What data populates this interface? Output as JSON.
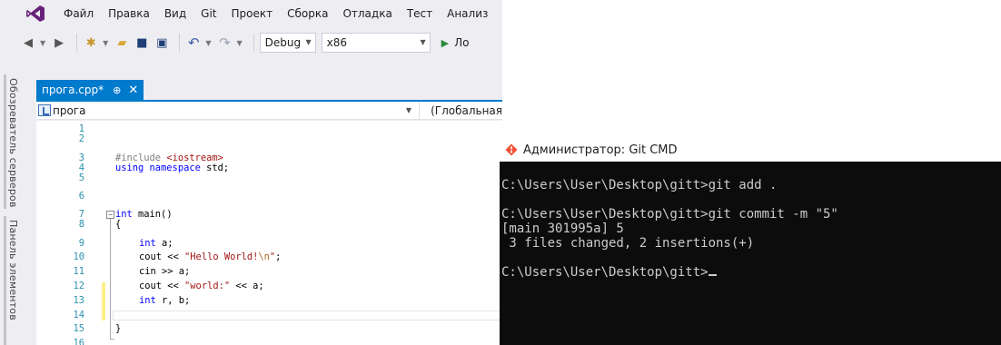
{
  "menu": [
    "Файл",
    "Правка",
    "Вид",
    "Git",
    "Проект",
    "Сборка",
    "Отладка",
    "Тест",
    "Анализ"
  ],
  "toolbar": {
    "config": "Debug",
    "platform": "x86",
    "run_label": "Ло"
  },
  "side_tabs": [
    "Обозреватель серверов",
    "Панель элементов"
  ],
  "editor_tab": {
    "title": "прога.cpp*",
    "pin_glyph": "⊕",
    "close_glyph": "✕"
  },
  "navbar": {
    "scope": "прога",
    "global": "(Глобальная"
  },
  "code": {
    "line_numbers": [
      "1",
      "2",
      "3",
      "4",
      "5",
      "6",
      "7",
      "8",
      "9",
      "10",
      "11",
      "12",
      "13",
      "14",
      "15",
      "16"
    ],
    "include_directive": "#include ",
    "include_header": "<iostream>",
    "using_kw": "using namespace",
    "using_rest": " std;",
    "main_kw": "int",
    "main_rest": " main()",
    "open_brace": "{",
    "l9_kw": "int",
    "l9_rest": " a;",
    "l10_pre": "cout << ",
    "l10_str1": "\"Hello World!",
    "l10_esc": "\\n",
    "l10_str2": "\"",
    "l10_post": ";",
    "l11": "cin >> a;",
    "l12_pre": "cout << ",
    "l12_str": "\"world:\"",
    "l12_post": " << a;",
    "l13_kw": "int",
    "l13_rest": " r, b;",
    "close_brace": "}"
  },
  "cmd": {
    "title": "Администратор: Git CMD",
    "lines": [
      "C:\\Users\\User\\Desktop\\gitt>git add .",
      "C:\\Users\\User\\Desktop\\gitt>git commit -m \"5\"",
      "[main 301995a] 5",
      " 3 files changed, 2 insertions(+)",
      "C:\\Users\\User\\Desktop\\gitt>"
    ]
  },
  "colors": {
    "vs_accent": "#007acc",
    "line_number": "#2b91af",
    "keyword": "#0000ff",
    "string": "#a31515",
    "console_bg": "#0c0c0c",
    "console_fg": "#cccccc"
  }
}
